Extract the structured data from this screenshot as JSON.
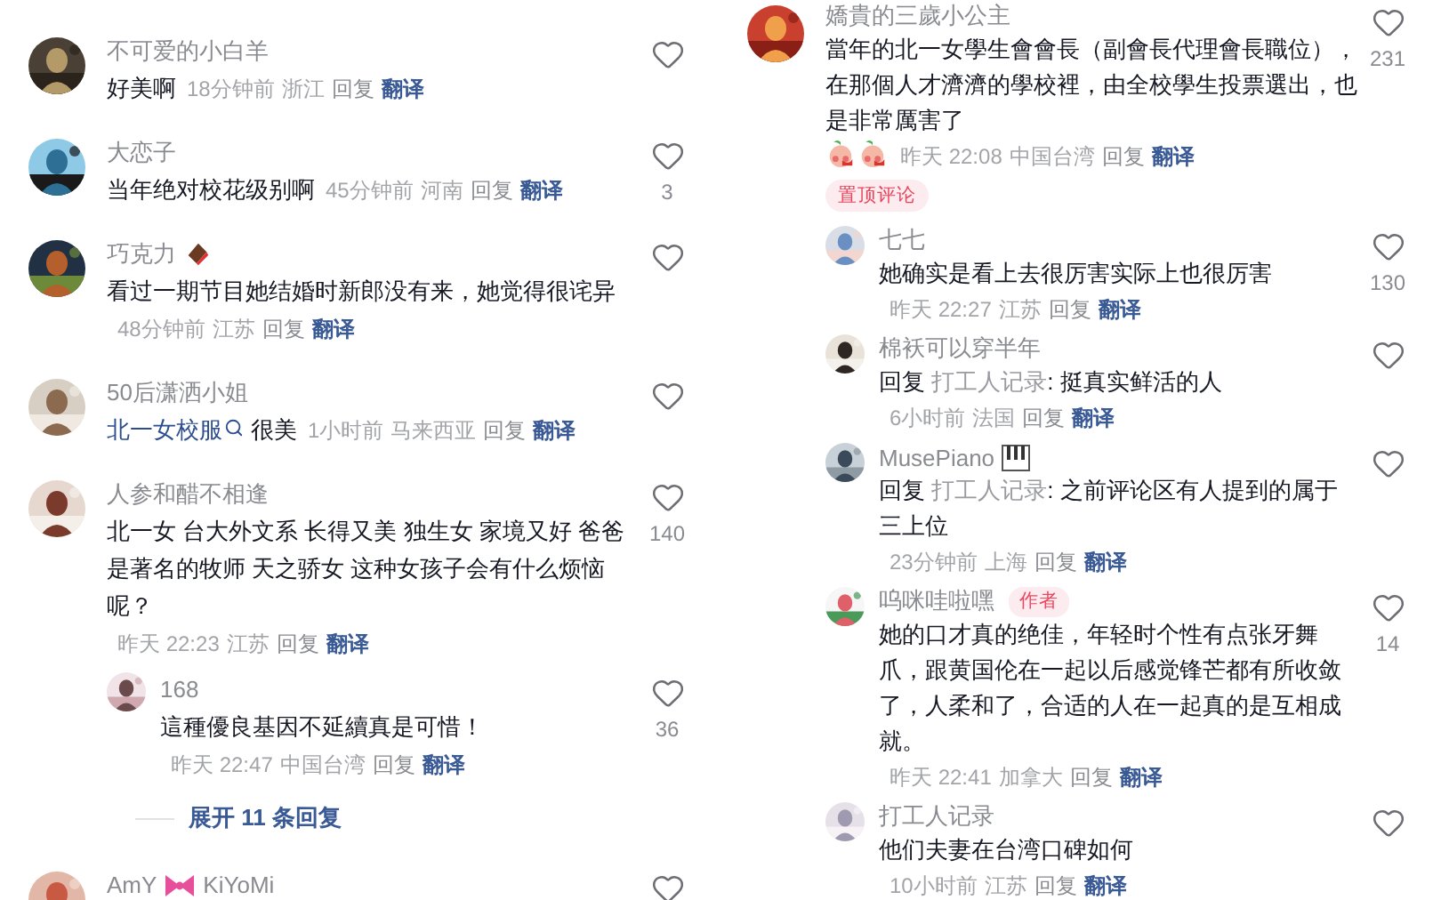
{
  "left": {
    "comments": [
      {
        "name": "不可爱的小白羊",
        "text": "好美啊",
        "time": "18分钟前",
        "location": "浙江",
        "reply": "回复",
        "translate": "翻译"
      },
      {
        "name": "大恋子",
        "text": "当年绝对校花级别啊",
        "time": "45分钟前",
        "location": "河南",
        "reply": "回复",
        "translate": "翻译",
        "likes": "3"
      },
      {
        "name": "巧克力",
        "name_icon": {
          "kind": "chocolate"
        },
        "text": "看过一期节目她结婚时新郎没有来，她觉得很诧异",
        "time": "48分钟前",
        "location": "江苏",
        "reply": "回复",
        "translate": "翻译"
      },
      {
        "name": "50后潇洒小姐",
        "link": "北一女校服",
        "text": "很美",
        "time": "1小时前",
        "location": "马来西亚",
        "reply": "回复",
        "translate": "翻译"
      },
      {
        "name": "人参和醋不相逢",
        "text": "北一女 台大外文系 长得又美 独生女 家境又好 爸爸是著名的牧师 天之骄女 这种女孩子会有什么烦恼呢？",
        "time": "昨天 22:23",
        "location": "江苏",
        "reply": "回复",
        "translate": "翻译",
        "likes": "140",
        "replies": [
          {
            "name": "168",
            "text": "這種優良基因不延續真是可惜！",
            "time": "昨天 22:47",
            "location": "中国台湾",
            "reply": "回复",
            "translate": "翻译",
            "likes": "36"
          }
        ],
        "expand": "展开 11 条回复"
      },
      {
        "name": "AmY",
        "name_icon": {
          "kind": "bow"
        },
        "name_after": "KiYoMi"
      }
    ]
  },
  "right": {
    "comments": [
      {
        "name": "嬌貴的三歲小公主",
        "text": "當年的北一女學生會會長（副會長代理會長職位），在那個人才濟濟的學校裡，由全校學生投票選出，也是非常厲害了",
        "emojis": [
          {
            "kind": "peach"
          },
          {
            "kind": "peach"
          }
        ],
        "time": "昨天 22:08",
        "location": "中国台湾",
        "reply": "回复",
        "translate": "翻译",
        "likes": "231",
        "pinned_label": "置顶评论",
        "replies": [
          {
            "name": "七七",
            "text": "她确实是看上去很厉害实际上也很厉害",
            "time": "昨天 22:27",
            "location": "江苏",
            "reply": "回复",
            "translate": "翻译",
            "likes": "130"
          },
          {
            "name": "棉袄可以穿半年",
            "reply_to": {
              "prefix": "回复",
              "user": "打工人记录"
            },
            "text": ": 挺真实鲜活的人",
            "time": "6小时前",
            "location": "法国",
            "reply": "回复",
            "translate": "翻译"
          },
          {
            "name": "MusePiano",
            "name_icon": {
              "kind": "piano"
            },
            "reply_to": {
              "prefix": "回复",
              "user": "打工人记录"
            },
            "text": ": 之前评论区有人提到的属于三上位",
            "time": "23分钟前",
            "location": "上海",
            "reply": "回复",
            "translate": "翻译"
          },
          {
            "name": "呜咪哇啦嘿",
            "badge": "作者",
            "text": "她的口才真的绝佳，年轻时个性有点张牙舞爪，跟黄国伦在一起以后感觉锋芒都有所收敛了，人柔和了，合适的人在一起真的是互相成就。",
            "time": "昨天 22:41",
            "location": "加拿大",
            "reply": "回复",
            "translate": "翻译",
            "likes": "14"
          },
          {
            "name": "打工人记录",
            "text": "他们夫妻在台湾口碑如何",
            "time": "10小时前",
            "location": "江苏",
            "reply": "回复",
            "translate": "翻译"
          }
        ]
      }
    ]
  }
}
